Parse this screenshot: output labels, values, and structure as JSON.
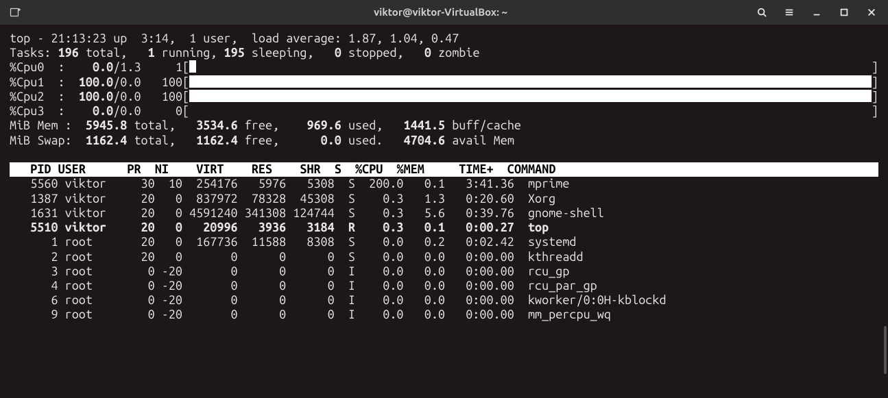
{
  "titlebar": {
    "title": "viktor@viktor-VirtualBox: ~",
    "new_tab_icon": "new-terminal-icon",
    "search_icon": "search-icon",
    "menu_icon": "hamburger-menu-icon",
    "minimize_icon": "minimize-icon",
    "maximize_icon": "maximize-icon",
    "close_icon": "close-icon"
  },
  "top": {
    "line1": "top - 21:13:23 up  3:14,  1 user,  load average: 1.87, 1.04, 0.47",
    "tasks_prefix": "Tasks: ",
    "tasks_total": "196",
    "tasks_total_lbl": " total,   ",
    "tasks_running": "1",
    "tasks_running_lbl": " running, ",
    "tasks_sleeping": "195",
    "tasks_sleeping_lbl": " sleeping,   ",
    "tasks_stopped": "0",
    "tasks_stopped_lbl": " stopped,   ",
    "tasks_zombie": "0",
    "tasks_zombie_lbl": " zombie",
    "cpus": [
      {
        "name": "%Cpu0  :  ",
        "val": "  0.0",
        "tail": "/1.3  ",
        "pct": "   1",
        "fill": 1
      },
      {
        "name": "%Cpu1  : ",
        "val": " 100.0",
        "tail": "/0.0  ",
        "pct": " 100",
        "fill": 100
      },
      {
        "name": "%Cpu2  : ",
        "val": " 100.0",
        "tail": "/0.0  ",
        "pct": " 100",
        "fill": 100
      },
      {
        "name": "%Cpu3  :  ",
        "val": "  0.0",
        "tail": "/0.0  ",
        "pct": "   0",
        "fill": 0
      }
    ],
    "mem_prefix": "MiB Mem :  ",
    "mem_total": "5945.8",
    "mem_total_lbl": " total,   ",
    "mem_free": "3534.6",
    "mem_free_lbl": " free,    ",
    "mem_used": "969.6",
    "mem_used_lbl": " used,   ",
    "mem_buff": "1441.5",
    "mem_buff_lbl": " buff/cache",
    "swap_prefix": "MiB Swap:  ",
    "swap_total": "1162.4",
    "swap_total_lbl": " total,   ",
    "swap_free": "1162.4",
    "swap_free_lbl": " free,      ",
    "swap_used": "0.0",
    "swap_used_lbl": " used.   ",
    "swap_avail": "4704.6",
    "swap_avail_lbl": " avail Mem"
  },
  "columns": {
    "pid": "   PID",
    "user": "USER    ",
    "pr": "  PR",
    "ni": "  NI",
    "virt": "    VIRT",
    "res": "    RES",
    "shr": "    SHR",
    "s": "S",
    "cpu": "  %CPU",
    "mem": "  %MEM",
    "time": "     TIME+",
    "cmd": "COMMAND"
  },
  "procs": [
    {
      "pid": "5560",
      "user": "viktor",
      "pr": "30",
      "ni": "10",
      "virt": "254176",
      "res": "5976",
      "shr": "5308",
      "s": "S",
      "cpu": "200.0",
      "mem": "0.1",
      "time": "3:41.36",
      "cmd": "mprime",
      "bold": false
    },
    {
      "pid": "1387",
      "user": "viktor",
      "pr": "20",
      "ni": "0",
      "virt": "837972",
      "res": "78328",
      "shr": "45308",
      "s": "S",
      "cpu": "0.3",
      "mem": "1.3",
      "time": "0:20.60",
      "cmd": "Xorg",
      "bold": false
    },
    {
      "pid": "1631",
      "user": "viktor",
      "pr": "20",
      "ni": "0",
      "virt": "4591240",
      "res": "341308",
      "shr": "124744",
      "s": "S",
      "cpu": "0.3",
      "mem": "5.6",
      "time": "0:39.76",
      "cmd": "gnome-shell",
      "bold": false
    },
    {
      "pid": "5510",
      "user": "viktor",
      "pr": "20",
      "ni": "0",
      "virt": "20996",
      "res": "3936",
      "shr": "3184",
      "s": "R",
      "cpu": "0.3",
      "mem": "0.1",
      "time": "0:00.27",
      "cmd": "top",
      "bold": true
    },
    {
      "pid": "1",
      "user": "root",
      "pr": "20",
      "ni": "0",
      "virt": "167736",
      "res": "11588",
      "shr": "8308",
      "s": "S",
      "cpu": "0.0",
      "mem": "0.2",
      "time": "0:02.42",
      "cmd": "systemd",
      "bold": false
    },
    {
      "pid": "2",
      "user": "root",
      "pr": "20",
      "ni": "0",
      "virt": "0",
      "res": "0",
      "shr": "0",
      "s": "S",
      "cpu": "0.0",
      "mem": "0.0",
      "time": "0:00.00",
      "cmd": "kthreadd",
      "bold": false
    },
    {
      "pid": "3",
      "user": "root",
      "pr": "0",
      "ni": "-20",
      "virt": "0",
      "res": "0",
      "shr": "0",
      "s": "I",
      "cpu": "0.0",
      "mem": "0.0",
      "time": "0:00.00",
      "cmd": "rcu_gp",
      "bold": false
    },
    {
      "pid": "4",
      "user": "root",
      "pr": "0",
      "ni": "-20",
      "virt": "0",
      "res": "0",
      "shr": "0",
      "s": "I",
      "cpu": "0.0",
      "mem": "0.0",
      "time": "0:00.00",
      "cmd": "rcu_par_gp",
      "bold": false
    },
    {
      "pid": "6",
      "user": "root",
      "pr": "0",
      "ni": "-20",
      "virt": "0",
      "res": "0",
      "shr": "0",
      "s": "I",
      "cpu": "0.0",
      "mem": "0.0",
      "time": "0:00.00",
      "cmd": "kworker/0:0H-kblockd",
      "bold": false
    },
    {
      "pid": "9",
      "user": "root",
      "pr": "0",
      "ni": "-20",
      "virt": "0",
      "res": "0",
      "shr": "0",
      "s": "I",
      "cpu": "0.0",
      "mem": "0.0",
      "time": "0:00.00",
      "cmd": "mm_percpu_wq",
      "bold": false
    }
  ]
}
